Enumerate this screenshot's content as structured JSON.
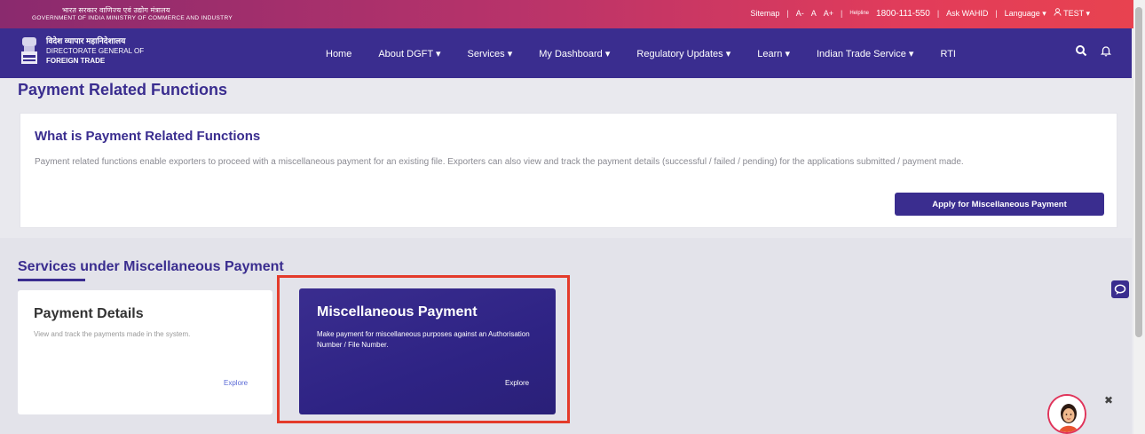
{
  "topbar": {
    "gov_hindi": "भारत सरकार वाणिज्य एवं उद्योग मंत्रालय",
    "gov_english": "GOVERNMENT OF INDIA MINISTRY OF COMMERCE AND INDUSTRY",
    "sitemap": "Sitemap",
    "font_small": "A-",
    "font_normal": "A",
    "font_large": "A+",
    "helpline_label": "Helpline",
    "phone": "1800-111-550",
    "ask_wahid": "Ask WAHID",
    "language": "Language",
    "user": "TEST"
  },
  "brand": {
    "hindi": "विदेश व्यापार महानिदेशालय",
    "line1": "DIRECTORATE GENERAL OF",
    "line2": "FOREIGN TRADE"
  },
  "nav": {
    "items": [
      "Home",
      "About DGFT",
      "Services",
      "My Dashboard",
      "Regulatory Updates",
      "Learn",
      "Indian Trade Service",
      "RTI"
    ],
    "dropdown_arrow": "▾"
  },
  "page": {
    "title": "Payment Related Functions"
  },
  "info": {
    "title": "What is Payment Related Functions",
    "description": "Payment related functions enable exporters to proceed with a miscellaneous payment for an existing file. Exporters can also view and track the payment details (successful / failed / pending) for the applications submitted / payment made.",
    "apply_button": "Apply for Miscellaneous Payment"
  },
  "services": {
    "title": "Services under Miscellaneous Payment",
    "cards": [
      {
        "title": "Payment Details",
        "description": "View and track the payments made in the system.",
        "explore": "Explore"
      },
      {
        "title": "Miscellaneous Payment",
        "description": "Make payment for miscellaneous purposes against an Authorisation Number / File Number.",
        "explore": "Explore"
      }
    ]
  },
  "colors": {
    "brand": "#3a2d8f",
    "topbar_start": "#8a2a6e",
    "topbar_end": "#e8434f",
    "highlight": "#e43b2b"
  },
  "icons": [
    "emblem-icon",
    "search-icon",
    "bell-icon",
    "chat-icon",
    "chatbot-avatar-icon",
    "close-icon",
    "user-icon"
  ]
}
